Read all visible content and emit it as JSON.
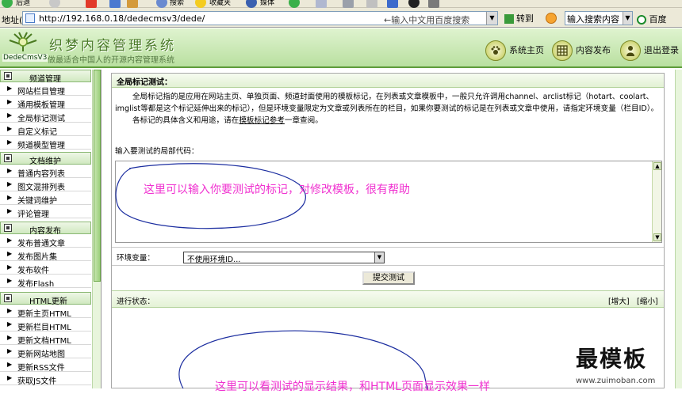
{
  "browser": {
    "back_label": "后退",
    "search_btn": "搜索",
    "favorites": "收藏夹",
    "media": "媒体",
    "address_label": "地址(D)",
    "url": "http://192.168.0.18/dedecmsv3/dede/",
    "search_hint": "←输入中文用百度搜索",
    "go_label": "转到",
    "search_box": "输入搜索内容",
    "baidu": "百度"
  },
  "header": {
    "logo_version": "DedeCmsV3",
    "title": "织梦内容管理系统",
    "subtitle": "做最适合中国人的开源内容管理系统",
    "nav": [
      {
        "label": "系统主页"
      },
      {
        "label": "内容发布"
      },
      {
        "label": "退出登录"
      }
    ]
  },
  "sidebar": {
    "groups": [
      {
        "title": "频道管理",
        "items": [
          "网站栏目管理",
          "通用模板管理",
          "全局标记测试",
          "自定义标记",
          "频道模型管理"
        ]
      },
      {
        "title": "文档维护",
        "items": [
          "普通内容列表",
          "图文混排列表",
          "关键词维护",
          "评论管理"
        ]
      },
      {
        "title": "内容发布",
        "items": [
          "发布普通文章",
          "发布图片集",
          "发布软件",
          "发布Flash"
        ]
      },
      {
        "title": "HTML更新",
        "items": [
          "更新主页HTML",
          "更新栏目HTML",
          "更新文档HTML",
          "更新网站地图",
          "更新RSS文件",
          "获取JS文件"
        ]
      }
    ]
  },
  "main": {
    "title": "全局标记测试：",
    "desc_1": "全局标记指的是应用在网站主页、单独页面、频道封面使用的模板标记，在列表或文章模板中，一般只允许调用channel、arclist标记（hotart、coolart、imglist等都是这个标记延伸出来的标记），但是环境变量限定为文章或列表所在的栏目，如果你要测试的标记是在列表或文章中使用，请指定环境变量（栏目ID）。",
    "desc_2_pre": "各标记的具体含义和用途，请在",
    "desc_2_link": "模板标记参考",
    "desc_2_post": "一章查阅。",
    "input_label": "输入要测试的局部代码：",
    "env_label": "环境变量：",
    "env_value": "不使用环境ID...",
    "submit_label": "提交测试",
    "status_label": "进行状态：",
    "zoom_in": "[增大]",
    "zoom_out": "[缩小]",
    "annotation_top": "这里可以输入你要测试的标记，对修改模板，很有帮助",
    "annotation_bottom": "这里可以看测试的显示结果，和HTML页面显示效果一样"
  },
  "watermark": {
    "text": "最模板",
    "url": "www.zuimoban.com"
  },
  "colors": {
    "annotation": "#f032d0",
    "header_green": "#b9e0a0",
    "accent": "#5e9c3a"
  }
}
